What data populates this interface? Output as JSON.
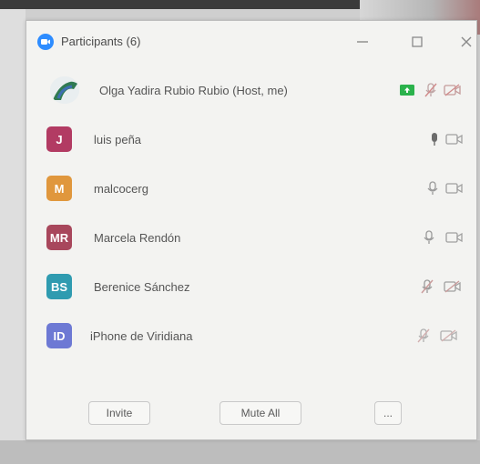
{
  "window": {
    "title": "Participants (6)"
  },
  "participants": [
    {
      "name": "Olga Yadira Rubio Rubio (Host, me)",
      "initials": "",
      "avatar_color": "#e6ecef",
      "mic": "muted",
      "video": "off"
    },
    {
      "name": "luis peña",
      "initials": "J",
      "avatar_color": "#b23b63",
      "mic": "on",
      "video": "off"
    },
    {
      "name": "malcocerg",
      "initials": "M",
      "avatar_color": "#e0973d",
      "mic": "on",
      "video": "off"
    },
    {
      "name": "Marcela Rendón",
      "initials": "MR",
      "avatar_color": "#a8475c",
      "mic": "on",
      "video": "off"
    },
    {
      "name": "Berenice Sánchez",
      "initials": "BS",
      "avatar_color": "#2f9bb0",
      "mic": "muted",
      "video": "off"
    },
    {
      "name": "iPhone de Viridiana",
      "initials": "ID",
      "avatar_color": "#6d79d4",
      "mic": "muted",
      "video": "off"
    }
  ],
  "footer": {
    "invite_label": "Invite",
    "mute_all_label": "Mute All",
    "more_label": "..."
  },
  "colors": {
    "zoom_blue": "#2d8cff",
    "share_green": "#2bb24c",
    "muted_red": "#d6a6a6",
    "icon_gray": "#9a9a9a"
  }
}
